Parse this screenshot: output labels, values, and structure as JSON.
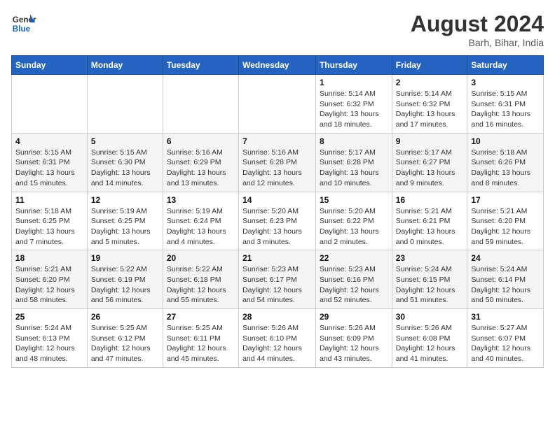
{
  "header": {
    "logo_general": "General",
    "logo_blue": "Blue",
    "month_year": "August 2024",
    "location": "Barh, Bihar, India"
  },
  "weekdays": [
    "Sunday",
    "Monday",
    "Tuesday",
    "Wednesday",
    "Thursday",
    "Friday",
    "Saturday"
  ],
  "weeks": [
    [
      {
        "day": "",
        "info": ""
      },
      {
        "day": "",
        "info": ""
      },
      {
        "day": "",
        "info": ""
      },
      {
        "day": "",
        "info": ""
      },
      {
        "day": "1",
        "info": "Sunrise: 5:14 AM\nSunset: 6:32 PM\nDaylight: 13 hours\nand 18 minutes."
      },
      {
        "day": "2",
        "info": "Sunrise: 5:14 AM\nSunset: 6:32 PM\nDaylight: 13 hours\nand 17 minutes."
      },
      {
        "day": "3",
        "info": "Sunrise: 5:15 AM\nSunset: 6:31 PM\nDaylight: 13 hours\nand 16 minutes."
      }
    ],
    [
      {
        "day": "4",
        "info": "Sunrise: 5:15 AM\nSunset: 6:31 PM\nDaylight: 13 hours\nand 15 minutes."
      },
      {
        "day": "5",
        "info": "Sunrise: 5:15 AM\nSunset: 6:30 PM\nDaylight: 13 hours\nand 14 minutes."
      },
      {
        "day": "6",
        "info": "Sunrise: 5:16 AM\nSunset: 6:29 PM\nDaylight: 13 hours\nand 13 minutes."
      },
      {
        "day": "7",
        "info": "Sunrise: 5:16 AM\nSunset: 6:28 PM\nDaylight: 13 hours\nand 12 minutes."
      },
      {
        "day": "8",
        "info": "Sunrise: 5:17 AM\nSunset: 6:28 PM\nDaylight: 13 hours\nand 10 minutes."
      },
      {
        "day": "9",
        "info": "Sunrise: 5:17 AM\nSunset: 6:27 PM\nDaylight: 13 hours\nand 9 minutes."
      },
      {
        "day": "10",
        "info": "Sunrise: 5:18 AM\nSunset: 6:26 PM\nDaylight: 13 hours\nand 8 minutes."
      }
    ],
    [
      {
        "day": "11",
        "info": "Sunrise: 5:18 AM\nSunset: 6:25 PM\nDaylight: 13 hours\nand 7 minutes."
      },
      {
        "day": "12",
        "info": "Sunrise: 5:19 AM\nSunset: 6:25 PM\nDaylight: 13 hours\nand 5 minutes."
      },
      {
        "day": "13",
        "info": "Sunrise: 5:19 AM\nSunset: 6:24 PM\nDaylight: 13 hours\nand 4 minutes."
      },
      {
        "day": "14",
        "info": "Sunrise: 5:20 AM\nSunset: 6:23 PM\nDaylight: 13 hours\nand 3 minutes."
      },
      {
        "day": "15",
        "info": "Sunrise: 5:20 AM\nSunset: 6:22 PM\nDaylight: 13 hours\nand 2 minutes."
      },
      {
        "day": "16",
        "info": "Sunrise: 5:21 AM\nSunset: 6:21 PM\nDaylight: 13 hours\nand 0 minutes."
      },
      {
        "day": "17",
        "info": "Sunrise: 5:21 AM\nSunset: 6:20 PM\nDaylight: 12 hours\nand 59 minutes."
      }
    ],
    [
      {
        "day": "18",
        "info": "Sunrise: 5:21 AM\nSunset: 6:20 PM\nDaylight: 12 hours\nand 58 minutes."
      },
      {
        "day": "19",
        "info": "Sunrise: 5:22 AM\nSunset: 6:19 PM\nDaylight: 12 hours\nand 56 minutes."
      },
      {
        "day": "20",
        "info": "Sunrise: 5:22 AM\nSunset: 6:18 PM\nDaylight: 12 hours\nand 55 minutes."
      },
      {
        "day": "21",
        "info": "Sunrise: 5:23 AM\nSunset: 6:17 PM\nDaylight: 12 hours\nand 54 minutes."
      },
      {
        "day": "22",
        "info": "Sunrise: 5:23 AM\nSunset: 6:16 PM\nDaylight: 12 hours\nand 52 minutes."
      },
      {
        "day": "23",
        "info": "Sunrise: 5:24 AM\nSunset: 6:15 PM\nDaylight: 12 hours\nand 51 minutes."
      },
      {
        "day": "24",
        "info": "Sunrise: 5:24 AM\nSunset: 6:14 PM\nDaylight: 12 hours\nand 50 minutes."
      }
    ],
    [
      {
        "day": "25",
        "info": "Sunrise: 5:24 AM\nSunset: 6:13 PM\nDaylight: 12 hours\nand 48 minutes."
      },
      {
        "day": "26",
        "info": "Sunrise: 5:25 AM\nSunset: 6:12 PM\nDaylight: 12 hours\nand 47 minutes."
      },
      {
        "day": "27",
        "info": "Sunrise: 5:25 AM\nSunset: 6:11 PM\nDaylight: 12 hours\nand 45 minutes."
      },
      {
        "day": "28",
        "info": "Sunrise: 5:26 AM\nSunset: 6:10 PM\nDaylight: 12 hours\nand 44 minutes."
      },
      {
        "day": "29",
        "info": "Sunrise: 5:26 AM\nSunset: 6:09 PM\nDaylight: 12 hours\nand 43 minutes."
      },
      {
        "day": "30",
        "info": "Sunrise: 5:26 AM\nSunset: 6:08 PM\nDaylight: 12 hours\nand 41 minutes."
      },
      {
        "day": "31",
        "info": "Sunrise: 5:27 AM\nSunset: 6:07 PM\nDaylight: 12 hours\nand 40 minutes."
      }
    ]
  ]
}
